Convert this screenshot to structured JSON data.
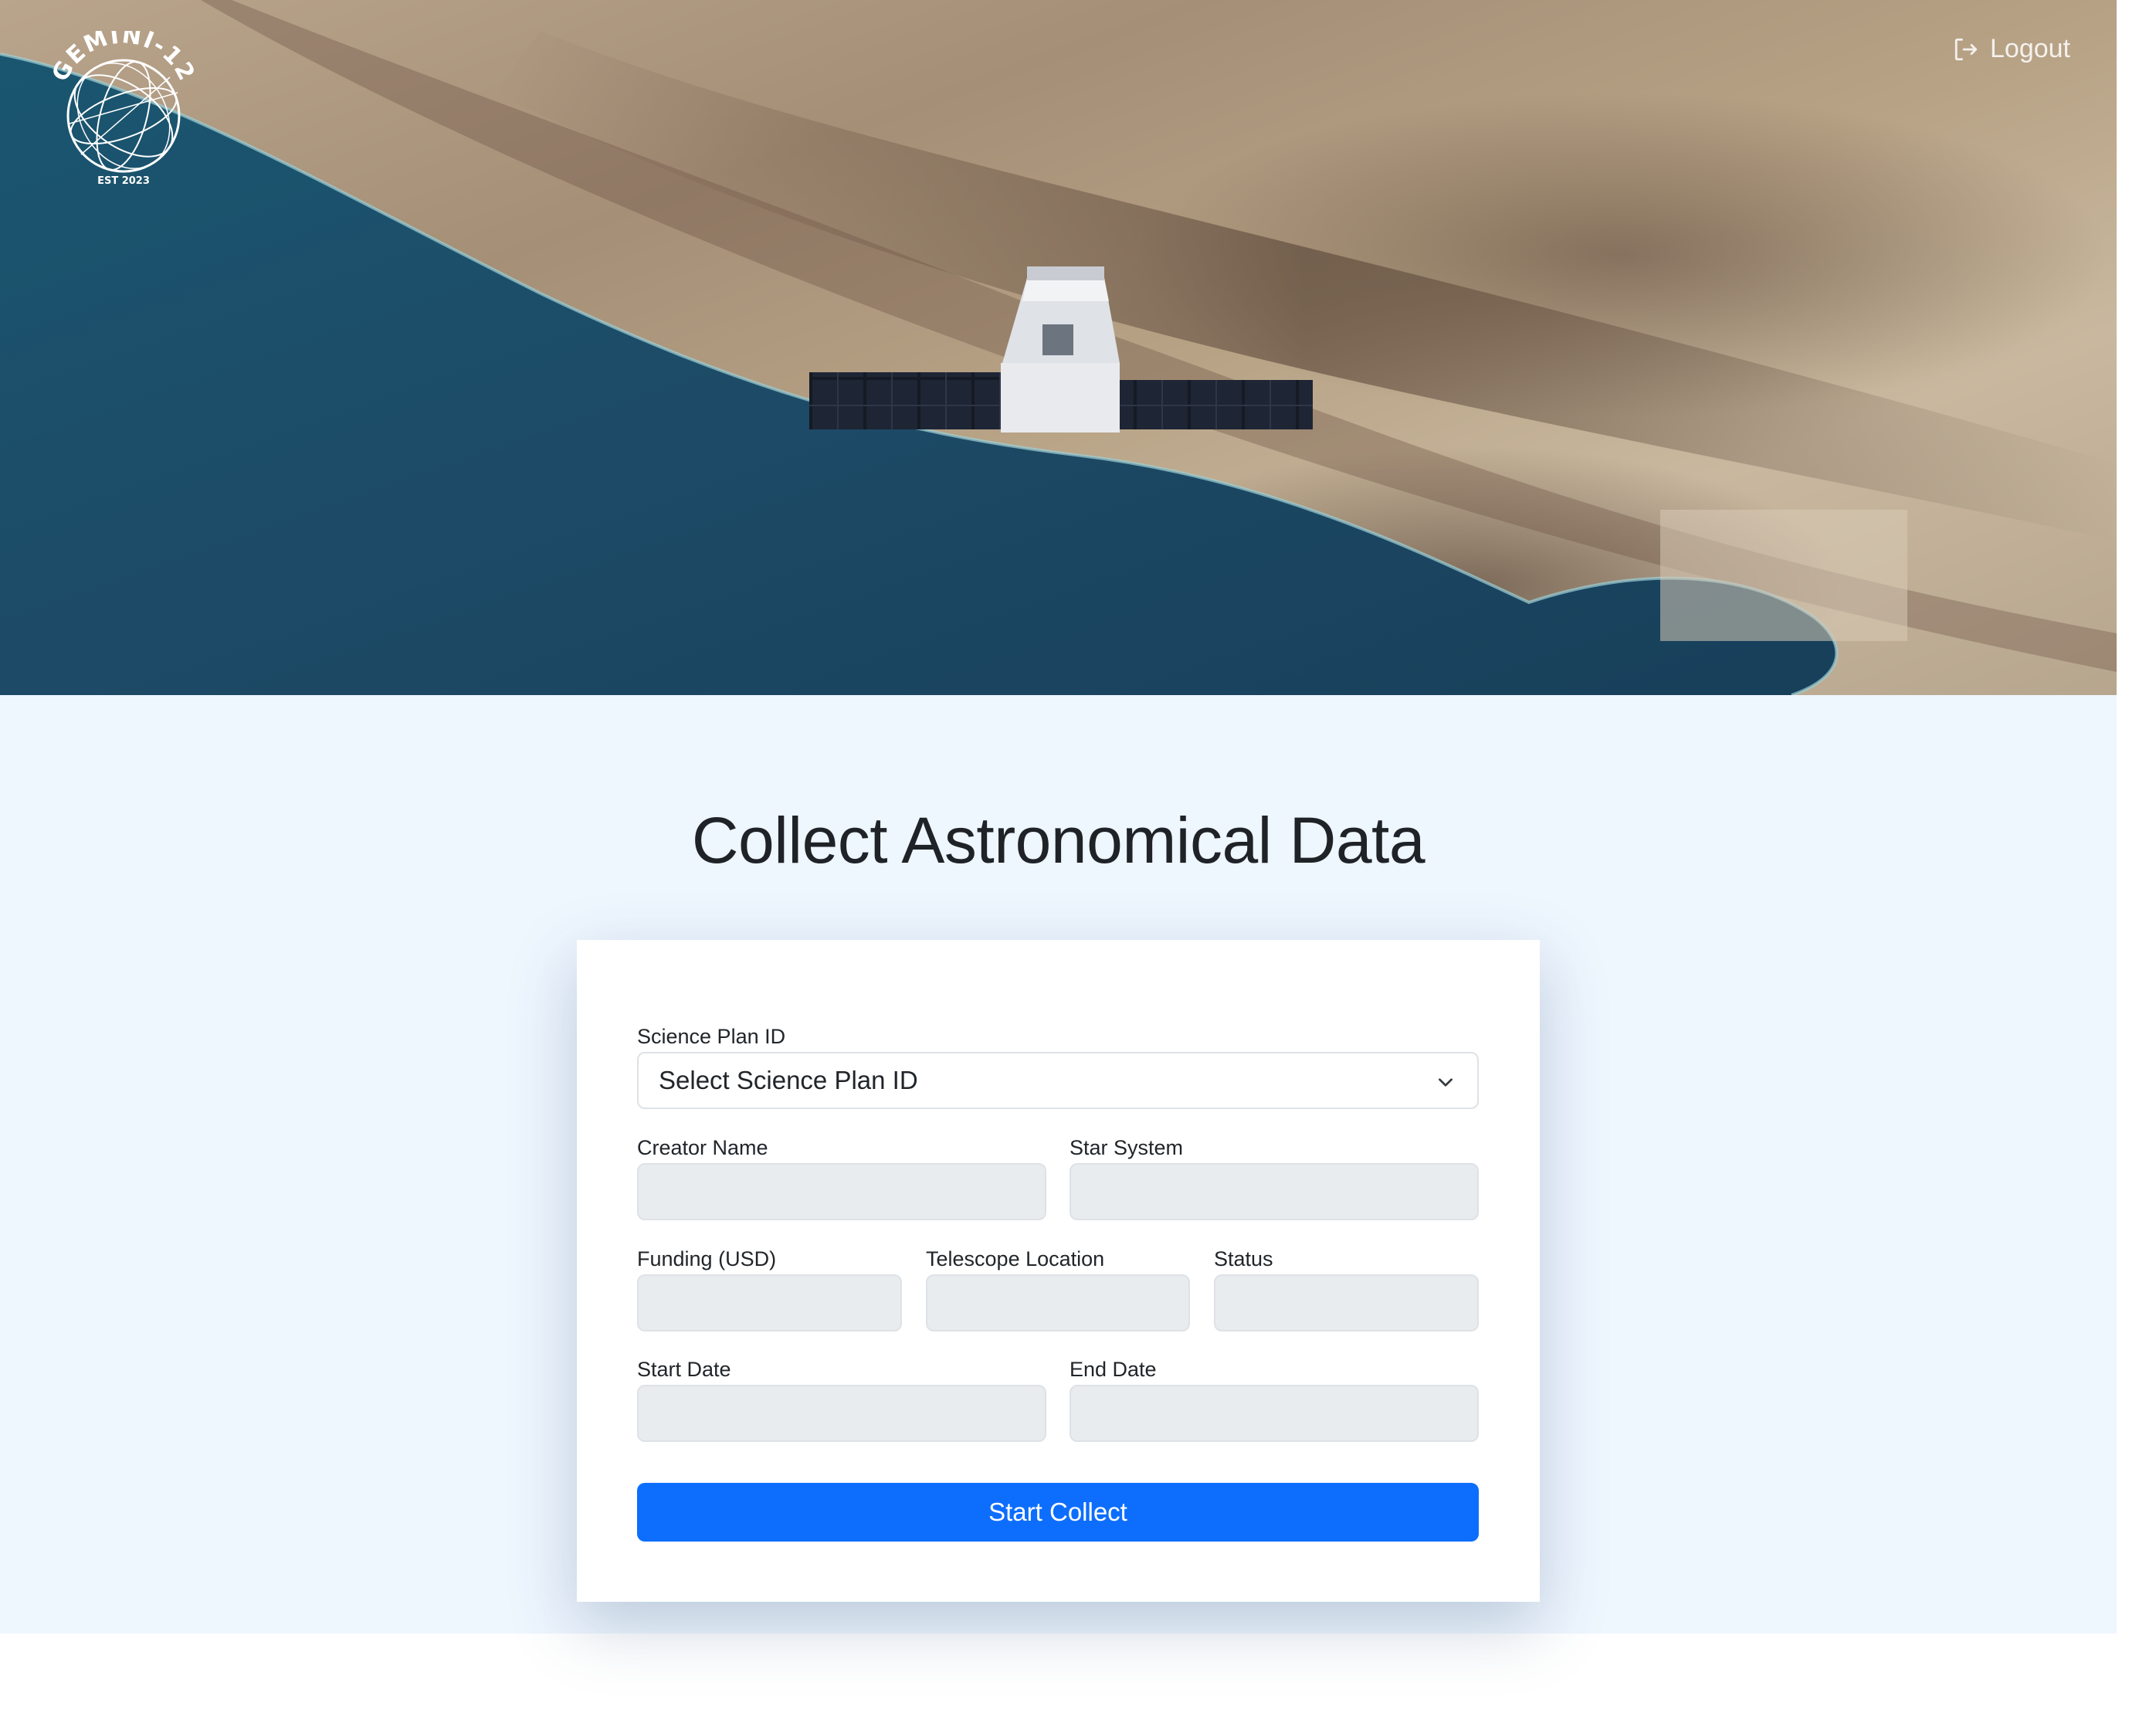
{
  "header": {
    "logo": {
      "brand_text": "GEMINI-12",
      "tagline": "EST 2023"
    },
    "logout_label": "Logout"
  },
  "hero": {
    "image_description_icon": "satellite-over-coastline-image"
  },
  "main": {
    "title": "Collect Astronomical Data",
    "form": {
      "science_plan": {
        "label": "Science Plan ID",
        "selected": "Select Science Plan ID"
      },
      "creator_name": {
        "label": "Creator Name",
        "value": ""
      },
      "star_system": {
        "label": "Star System",
        "value": ""
      },
      "funding": {
        "label": "Funding (USD)",
        "value": ""
      },
      "telescope_location": {
        "label": "Telescope Location",
        "value": ""
      },
      "status": {
        "label": "Status",
        "value": ""
      },
      "start_date": {
        "label": "Start Date",
        "value": ""
      },
      "end_date": {
        "label": "End Date",
        "value": ""
      },
      "submit_label": "Start Collect"
    }
  },
  "colors": {
    "primary": "#0d6efd",
    "page_background": "#eef6fe",
    "readonly_input": "#e9ecef",
    "ocean": "#1d4a66"
  }
}
